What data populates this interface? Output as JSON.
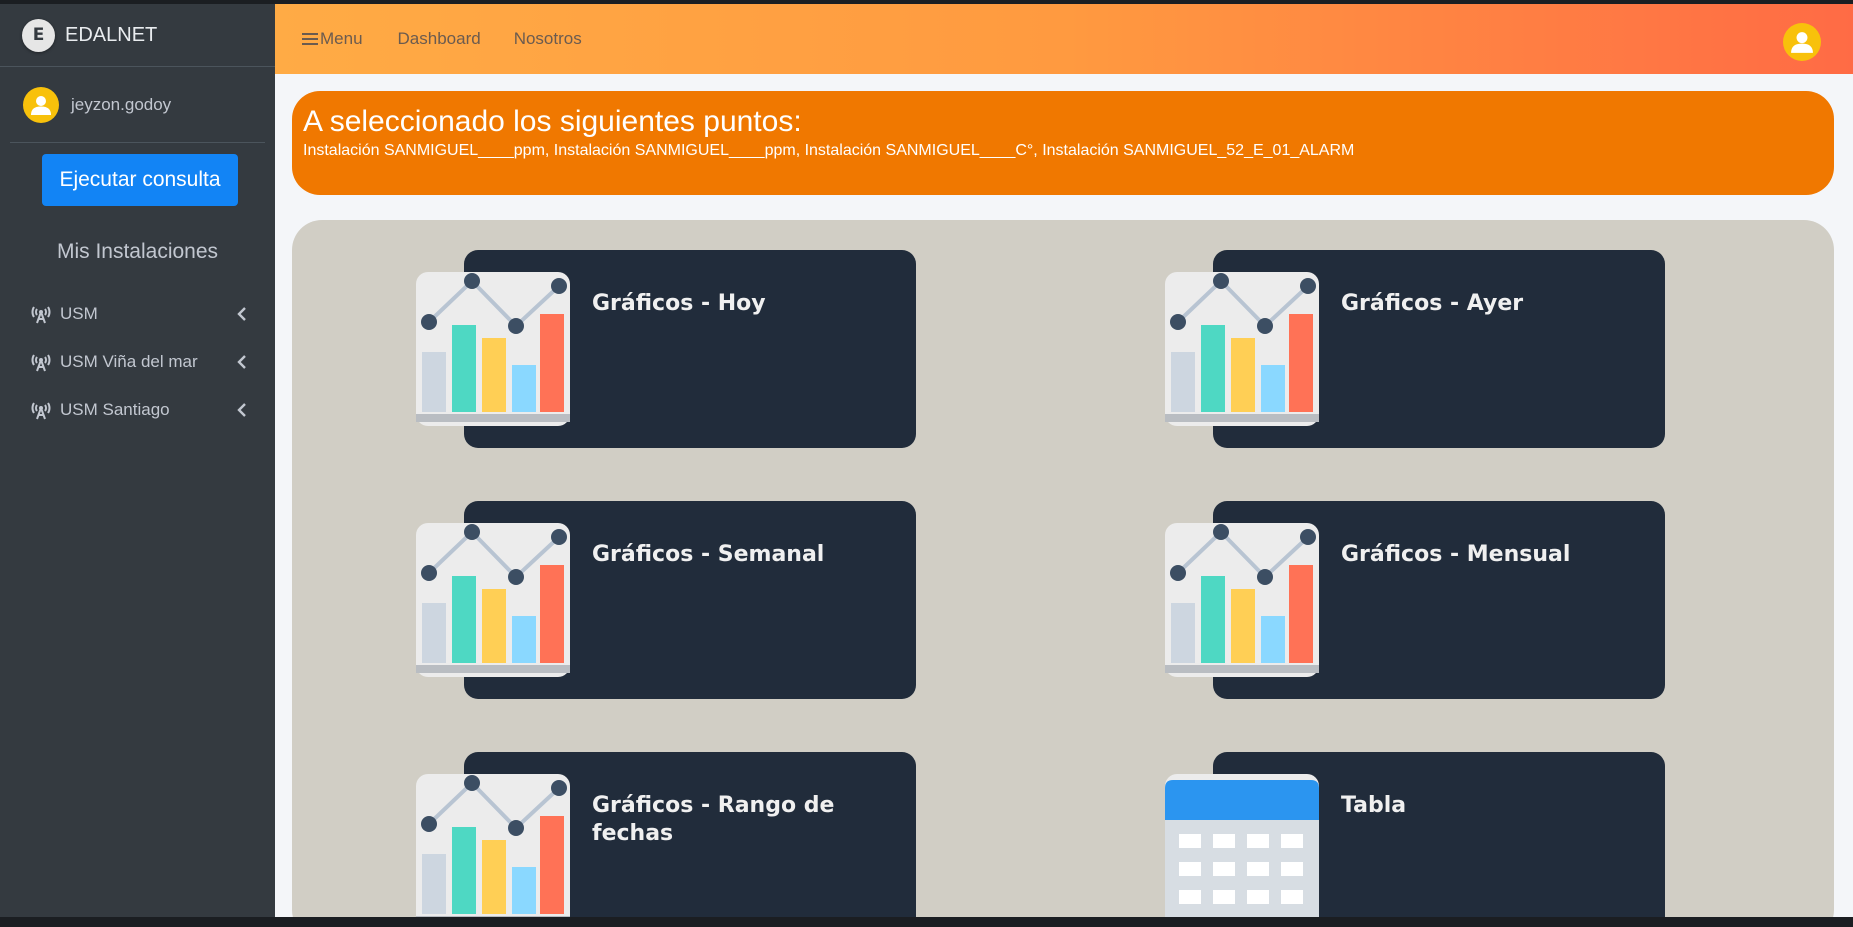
{
  "brand": {
    "name": "EDALNET",
    "logo_letter": "E"
  },
  "user": {
    "name": "jeyzon.godoy"
  },
  "sidebar": {
    "run_button": "Ejecutar consulta",
    "section_title": "Mis Instalaciones",
    "items": [
      {
        "label": "USM",
        "icon": "antenna-icon"
      },
      {
        "label": "USM Viña del mar",
        "icon": "antenna-icon"
      },
      {
        "label": "USM Santiago",
        "icon": "antenna-icon"
      }
    ]
  },
  "topbar": {
    "menu": "Menu",
    "dashboard": "Dashboard",
    "about": "Nosotros"
  },
  "banner": {
    "title": "A seleccionado los siguientes puntos:",
    "points": "Instalación SANMIGUEL____ppm, Instalación SANMIGUEL____ppm, Instalación SANMIGUEL____C°, Instalación SANMIGUEL_52_E_01_ALARM"
  },
  "cards": [
    {
      "title": "Gráficos - Hoy",
      "icon": "bar-chart-icon"
    },
    {
      "title": "Gráficos - Ayer",
      "icon": "bar-chart-icon"
    },
    {
      "title": "Gráficos - Semanal",
      "icon": "bar-chart-icon"
    },
    {
      "title": "Gráficos - Mensual",
      "icon": "bar-chart-icon"
    },
    {
      "title": "Gráficos - Rango de fechas",
      "icon": "bar-chart-icon"
    },
    {
      "title": "Tabla",
      "icon": "calendar-table-icon"
    }
  ],
  "colors": {
    "sidebar_bg": "#343a40",
    "accent_button": "#1284f5",
    "banner_bg": "#f07800",
    "card_bg": "#212c3b",
    "panel_bg": "#d1cec5"
  }
}
